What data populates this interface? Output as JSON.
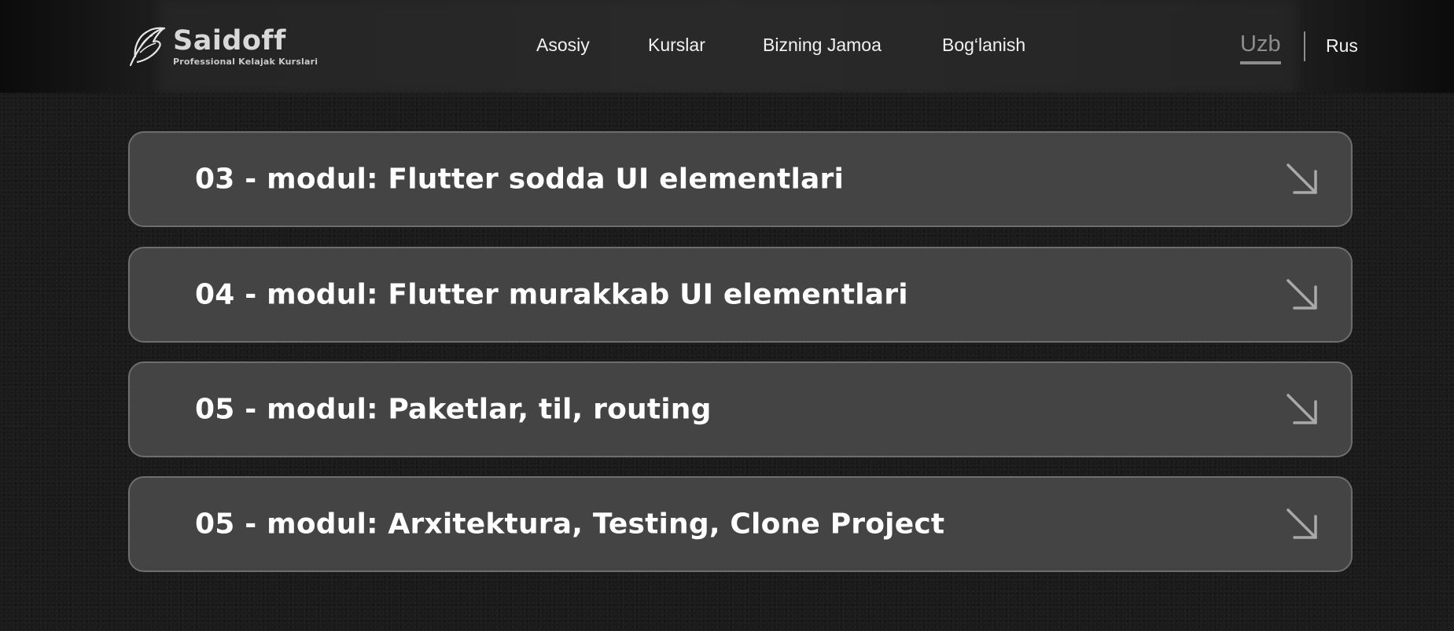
{
  "header": {
    "logo": {
      "name": "Saidoff",
      "tagline": "Professional Kelajak Kurslari",
      "icon": "feather-logo-icon"
    },
    "nav": [
      {
        "label": "Asosiy"
      },
      {
        "label": "Kurslar"
      },
      {
        "label": "Bizning Jamoa"
      },
      {
        "label": "Bog‘lanish"
      }
    ],
    "languages": {
      "active": "Uzb",
      "other": "Rus"
    }
  },
  "modules": [
    {
      "title": "03 - modul: Flutter sodda UI elementlari",
      "icon": "arrow-down-right-icon"
    },
    {
      "title": "04 - modul: Flutter murakkab UI elementlari",
      "icon": "arrow-down-right-icon"
    },
    {
      "title": "05 - modul: Paketlar, til, routing",
      "icon": "arrow-down-right-icon"
    },
    {
      "title": "05 - modul: Arxitektura, Testing, Clone Project",
      "icon": "arrow-down-right-icon"
    }
  ],
  "colors": {
    "background": "#1b1b1b",
    "card": "#444444",
    "card_border": "#6e6e6e",
    "text": "#ffffff",
    "muted": "#8d8d8d"
  }
}
